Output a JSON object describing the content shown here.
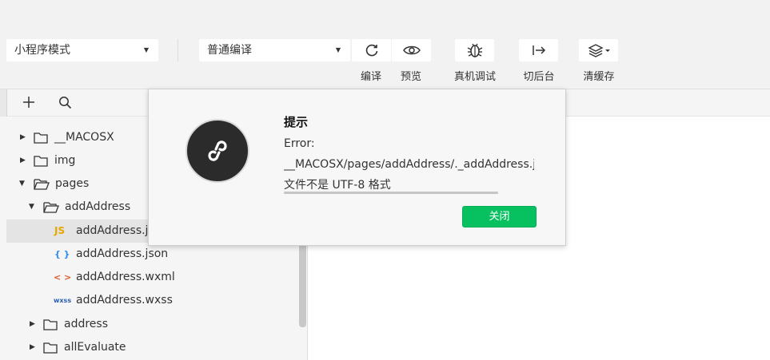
{
  "toolbar": {
    "mode_select": "小程序模式",
    "compile_select": "普通编译",
    "buttons": [
      {
        "label": "编译",
        "icon": "refresh-icon"
      },
      {
        "label": "预览",
        "icon": "eye-icon"
      },
      {
        "label": "真机调试",
        "icon": "bug-icon"
      },
      {
        "label": "切后台",
        "icon": "switch-background-icon"
      },
      {
        "label": "清缓存",
        "icon": "layers-icon"
      }
    ]
  },
  "sidebar": {
    "tree": [
      {
        "label": "__MACOSX",
        "type": "folder",
        "expanded": false
      },
      {
        "label": "img",
        "type": "folder",
        "expanded": false
      },
      {
        "label": "pages",
        "type": "folder",
        "expanded": true
      },
      {
        "label": "addAddress",
        "type": "folder",
        "expanded": true
      },
      {
        "label": "addAddress.js",
        "type": "file",
        "badge": "JS",
        "selected": true
      },
      {
        "label": "addAddress.json",
        "type": "file",
        "badge": "{ }"
      },
      {
        "label": "addAddress.wxml",
        "type": "file",
        "badge": "< >"
      },
      {
        "label": "addAddress.wxss",
        "type": "file",
        "badge": "wxss"
      },
      {
        "label": "address",
        "type": "folder",
        "expanded": false
      },
      {
        "label": "allEvaluate",
        "type": "folder",
        "expanded": false
      }
    ]
  },
  "dialog": {
    "title": "提示",
    "line1": "Error:",
    "line2": "__MACOSX/pages/addAddress/._addAddress.js",
    "line3": "文件不是 UTF-8 格式",
    "close_label": "关闭"
  },
  "colors": {
    "accent": "#07c160",
    "js_badge": "#e6a700",
    "json_badge": "#2d8cf0",
    "wxml_badge": "#e0592a",
    "wxss_badge": "#2a5db0"
  }
}
